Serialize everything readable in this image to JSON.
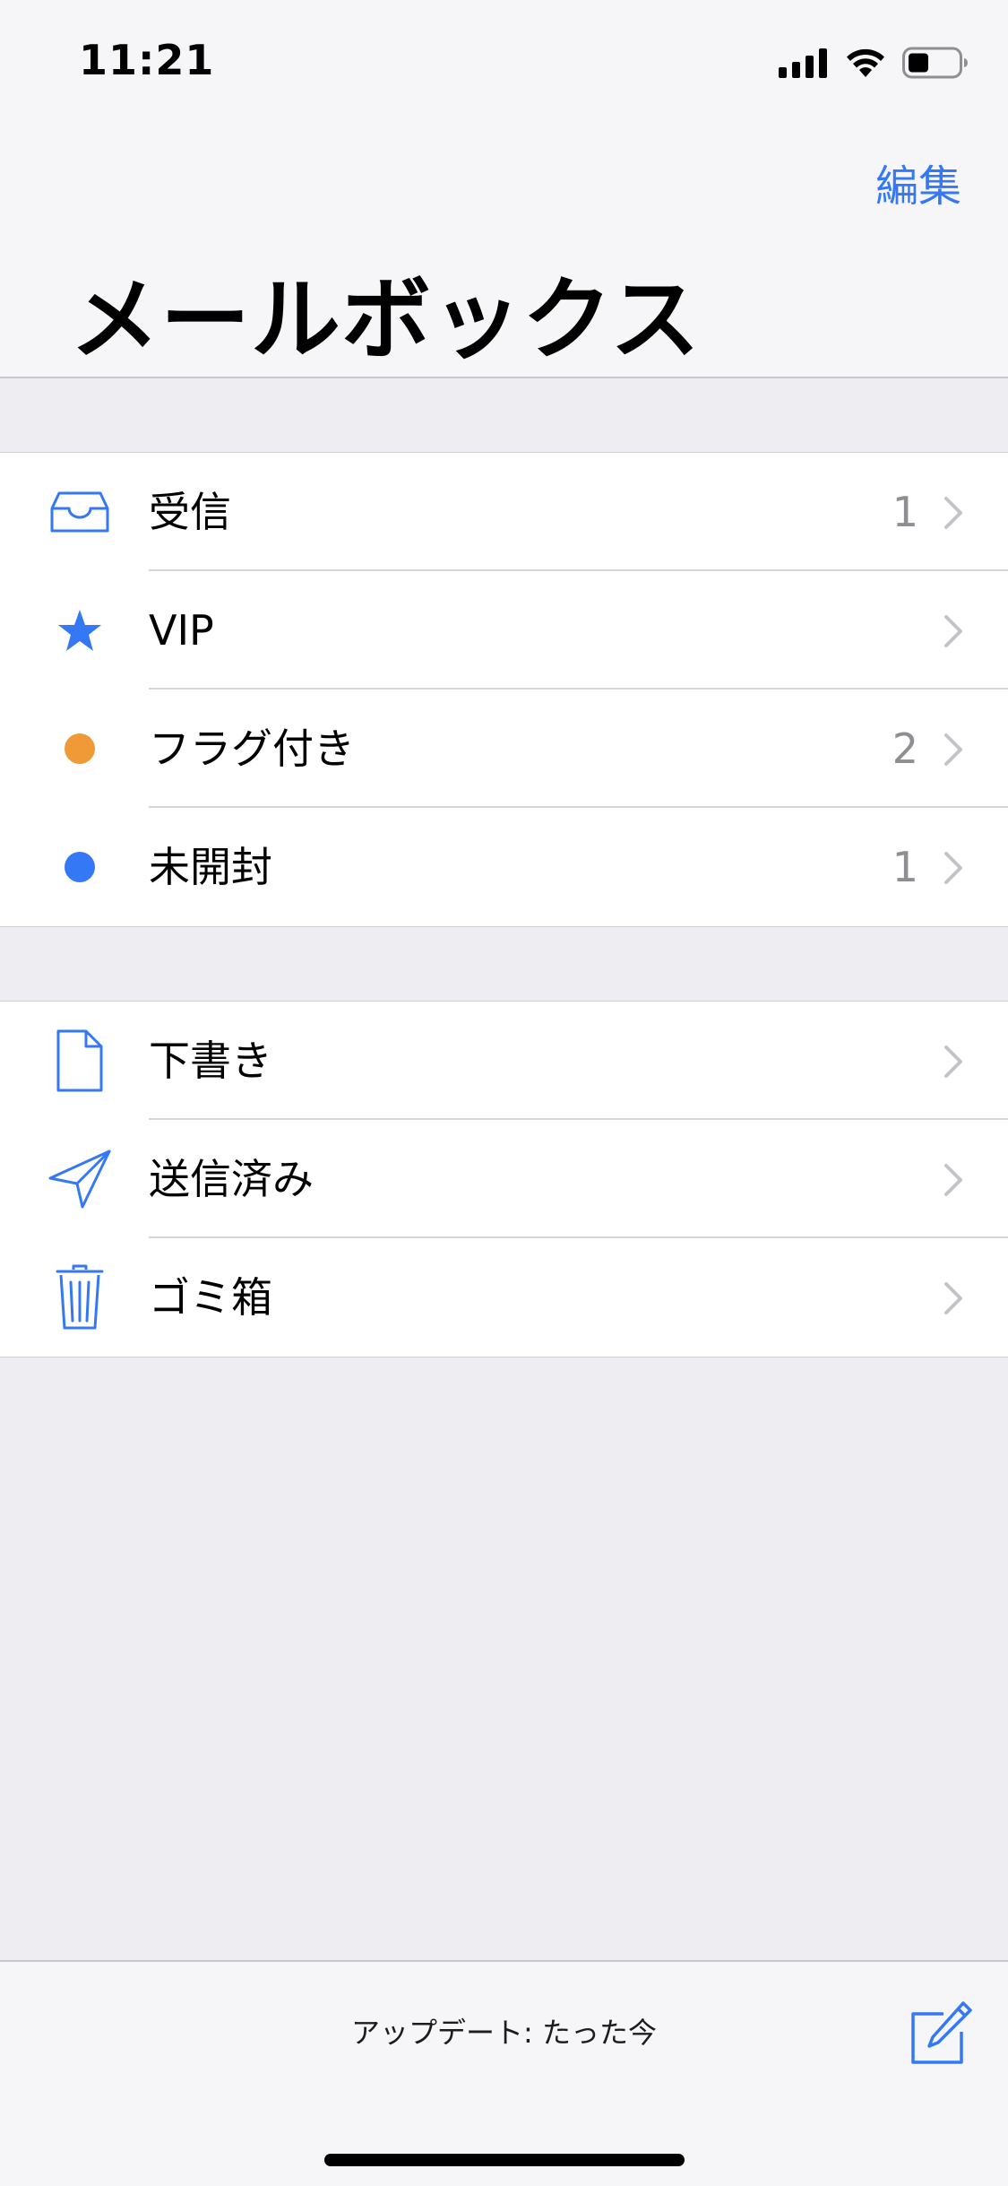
{
  "status_bar": {
    "time": "11:21"
  },
  "header": {
    "edit_label": "編集",
    "title": "メールボックス"
  },
  "colors": {
    "accent": "#3478f6",
    "flag": "#f09a37",
    "unread": "#3478f6",
    "secondary_text": "#8e8e93"
  },
  "sections": [
    {
      "rows": [
        {
          "icon": "inbox-icon",
          "label": "受信",
          "count": "1"
        },
        {
          "icon": "star-icon",
          "label": "VIP",
          "count": ""
        },
        {
          "icon": "flag-dot-icon",
          "label": "フラグ付き",
          "count": "2"
        },
        {
          "icon": "unread-dot-icon",
          "label": "未開封",
          "count": "1"
        }
      ]
    },
    {
      "rows": [
        {
          "icon": "document-icon",
          "label": "下書き",
          "count": ""
        },
        {
          "icon": "paper-plane-icon",
          "label": "送信済み",
          "count": ""
        },
        {
          "icon": "trash-icon",
          "label": "ゴミ箱",
          "count": ""
        }
      ]
    }
  ],
  "toolbar": {
    "update_status": "アップデート: たった今",
    "compose_icon": "compose-icon"
  }
}
